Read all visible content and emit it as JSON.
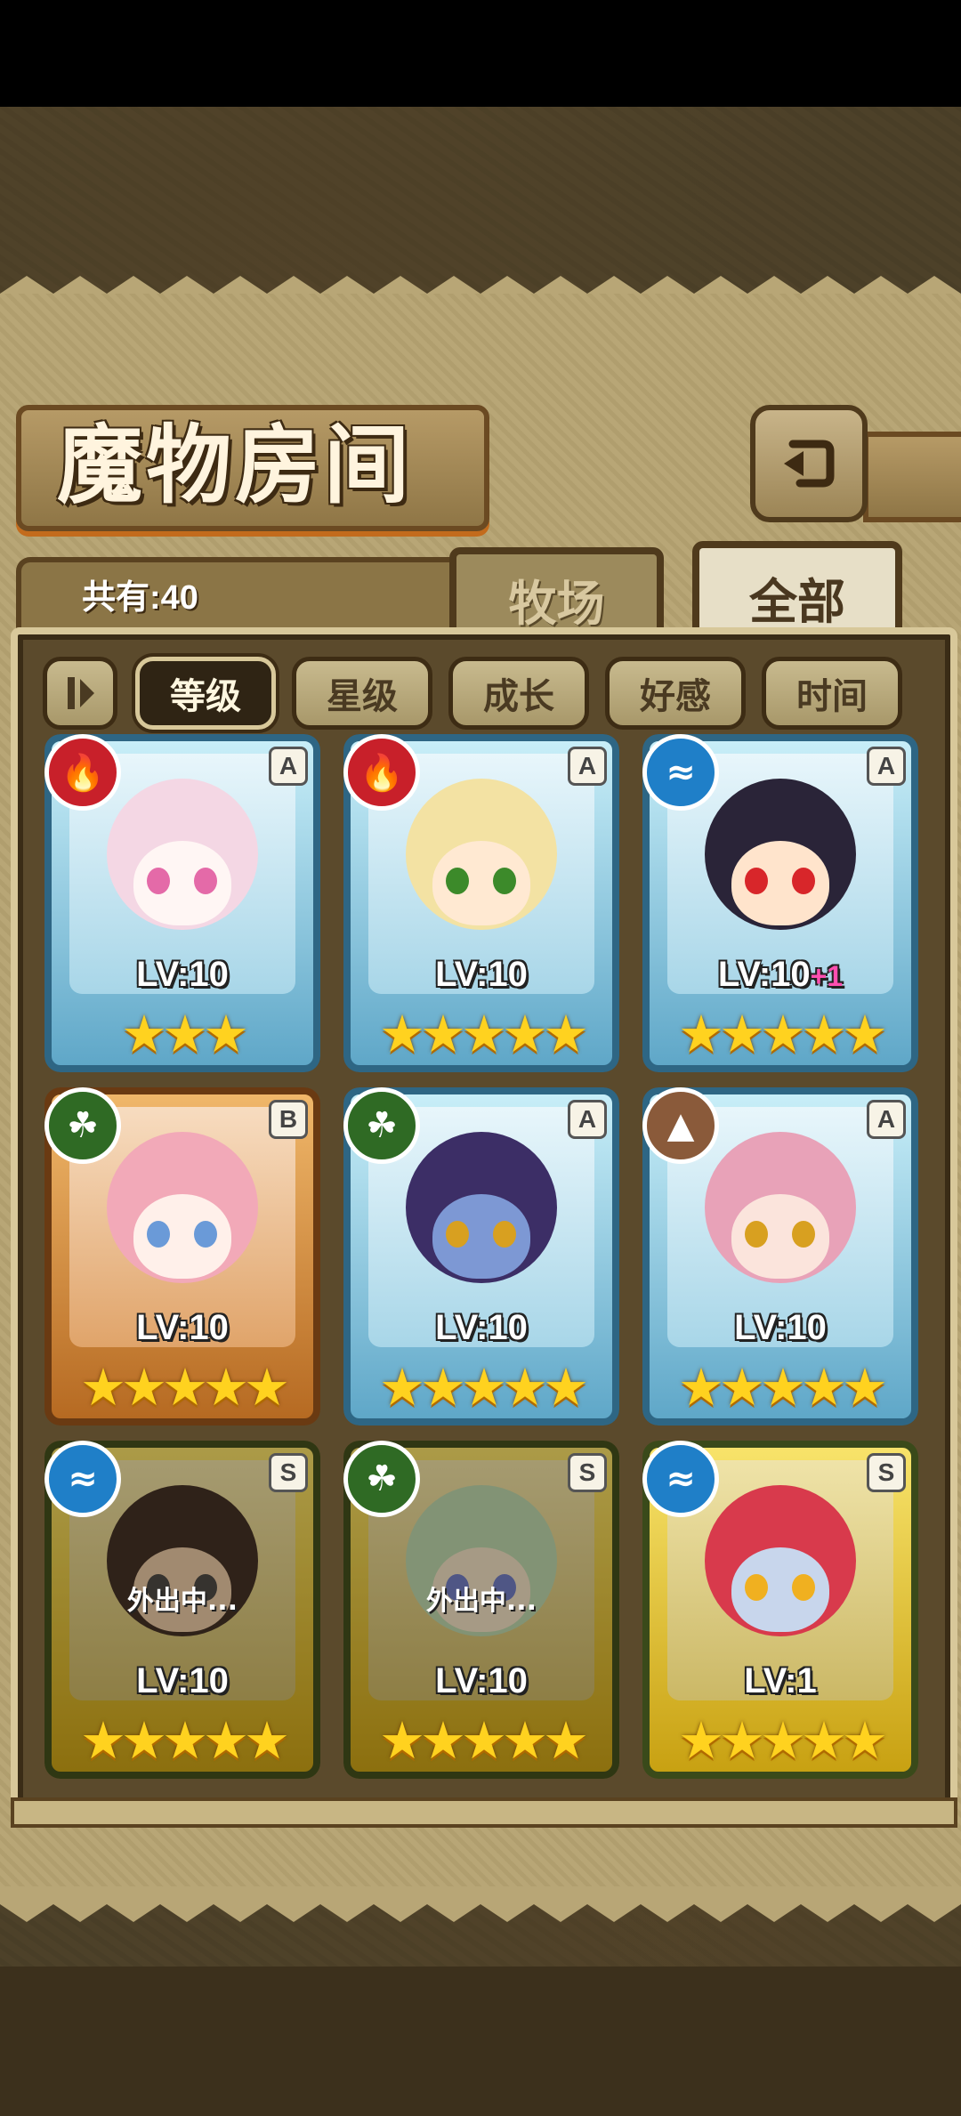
{
  "title": "魔物房间",
  "count_label": "共有:40",
  "tabs": [
    {
      "label": "牧场",
      "active": false
    },
    {
      "label": "全部",
      "active": true
    }
  ],
  "filters": [
    {
      "label": "等级",
      "active": true
    },
    {
      "label": "星级",
      "active": false
    },
    {
      "label": "成长",
      "active": false
    },
    {
      "label": "好感",
      "active": false
    },
    {
      "label": "时间",
      "active": false
    }
  ],
  "cards": [
    {
      "element": "fire",
      "rank": "A",
      "level": "LV:10",
      "bonus": "",
      "stars": "★★★",
      "frame": "blue",
      "status": ""
    },
    {
      "element": "fire",
      "rank": "A",
      "level": "LV:10",
      "bonus": "",
      "stars": "★★★★★",
      "frame": "blue",
      "status": ""
    },
    {
      "element": "water",
      "rank": "A",
      "level": "LV:10",
      "bonus": "+1",
      "stars": "★★★★★",
      "frame": "blue",
      "status": ""
    },
    {
      "element": "wood",
      "rank": "B",
      "level": "LV:10",
      "bonus": "",
      "stars": "★★★★★",
      "frame": "bronze",
      "status": ""
    },
    {
      "element": "wood",
      "rank": "A",
      "level": "LV:10",
      "bonus": "",
      "stars": "★★★★★",
      "frame": "blue",
      "status": ""
    },
    {
      "element": "earth",
      "rank": "A",
      "level": "LV:10",
      "bonus": "",
      "stars": "★★★★★",
      "frame": "blue",
      "status": ""
    },
    {
      "element": "water",
      "rank": "S",
      "level": "LV:10",
      "bonus": "",
      "stars": "★★★★★",
      "frame": "gold",
      "status": "外出中..."
    },
    {
      "element": "wood",
      "rank": "S",
      "level": "LV:10",
      "bonus": "",
      "stars": "★★★★★",
      "frame": "gold",
      "status": "外出中..."
    },
    {
      "element": "water",
      "rank": "S",
      "level": "LV:1",
      "bonus": "",
      "stars": "★★★★★",
      "frame": "gold",
      "status": ""
    }
  ],
  "colors": {
    "fire": "#c8202a",
    "water": "#1f7fc8",
    "wood": "#2f6a24",
    "earth": "#8a5a3a"
  }
}
